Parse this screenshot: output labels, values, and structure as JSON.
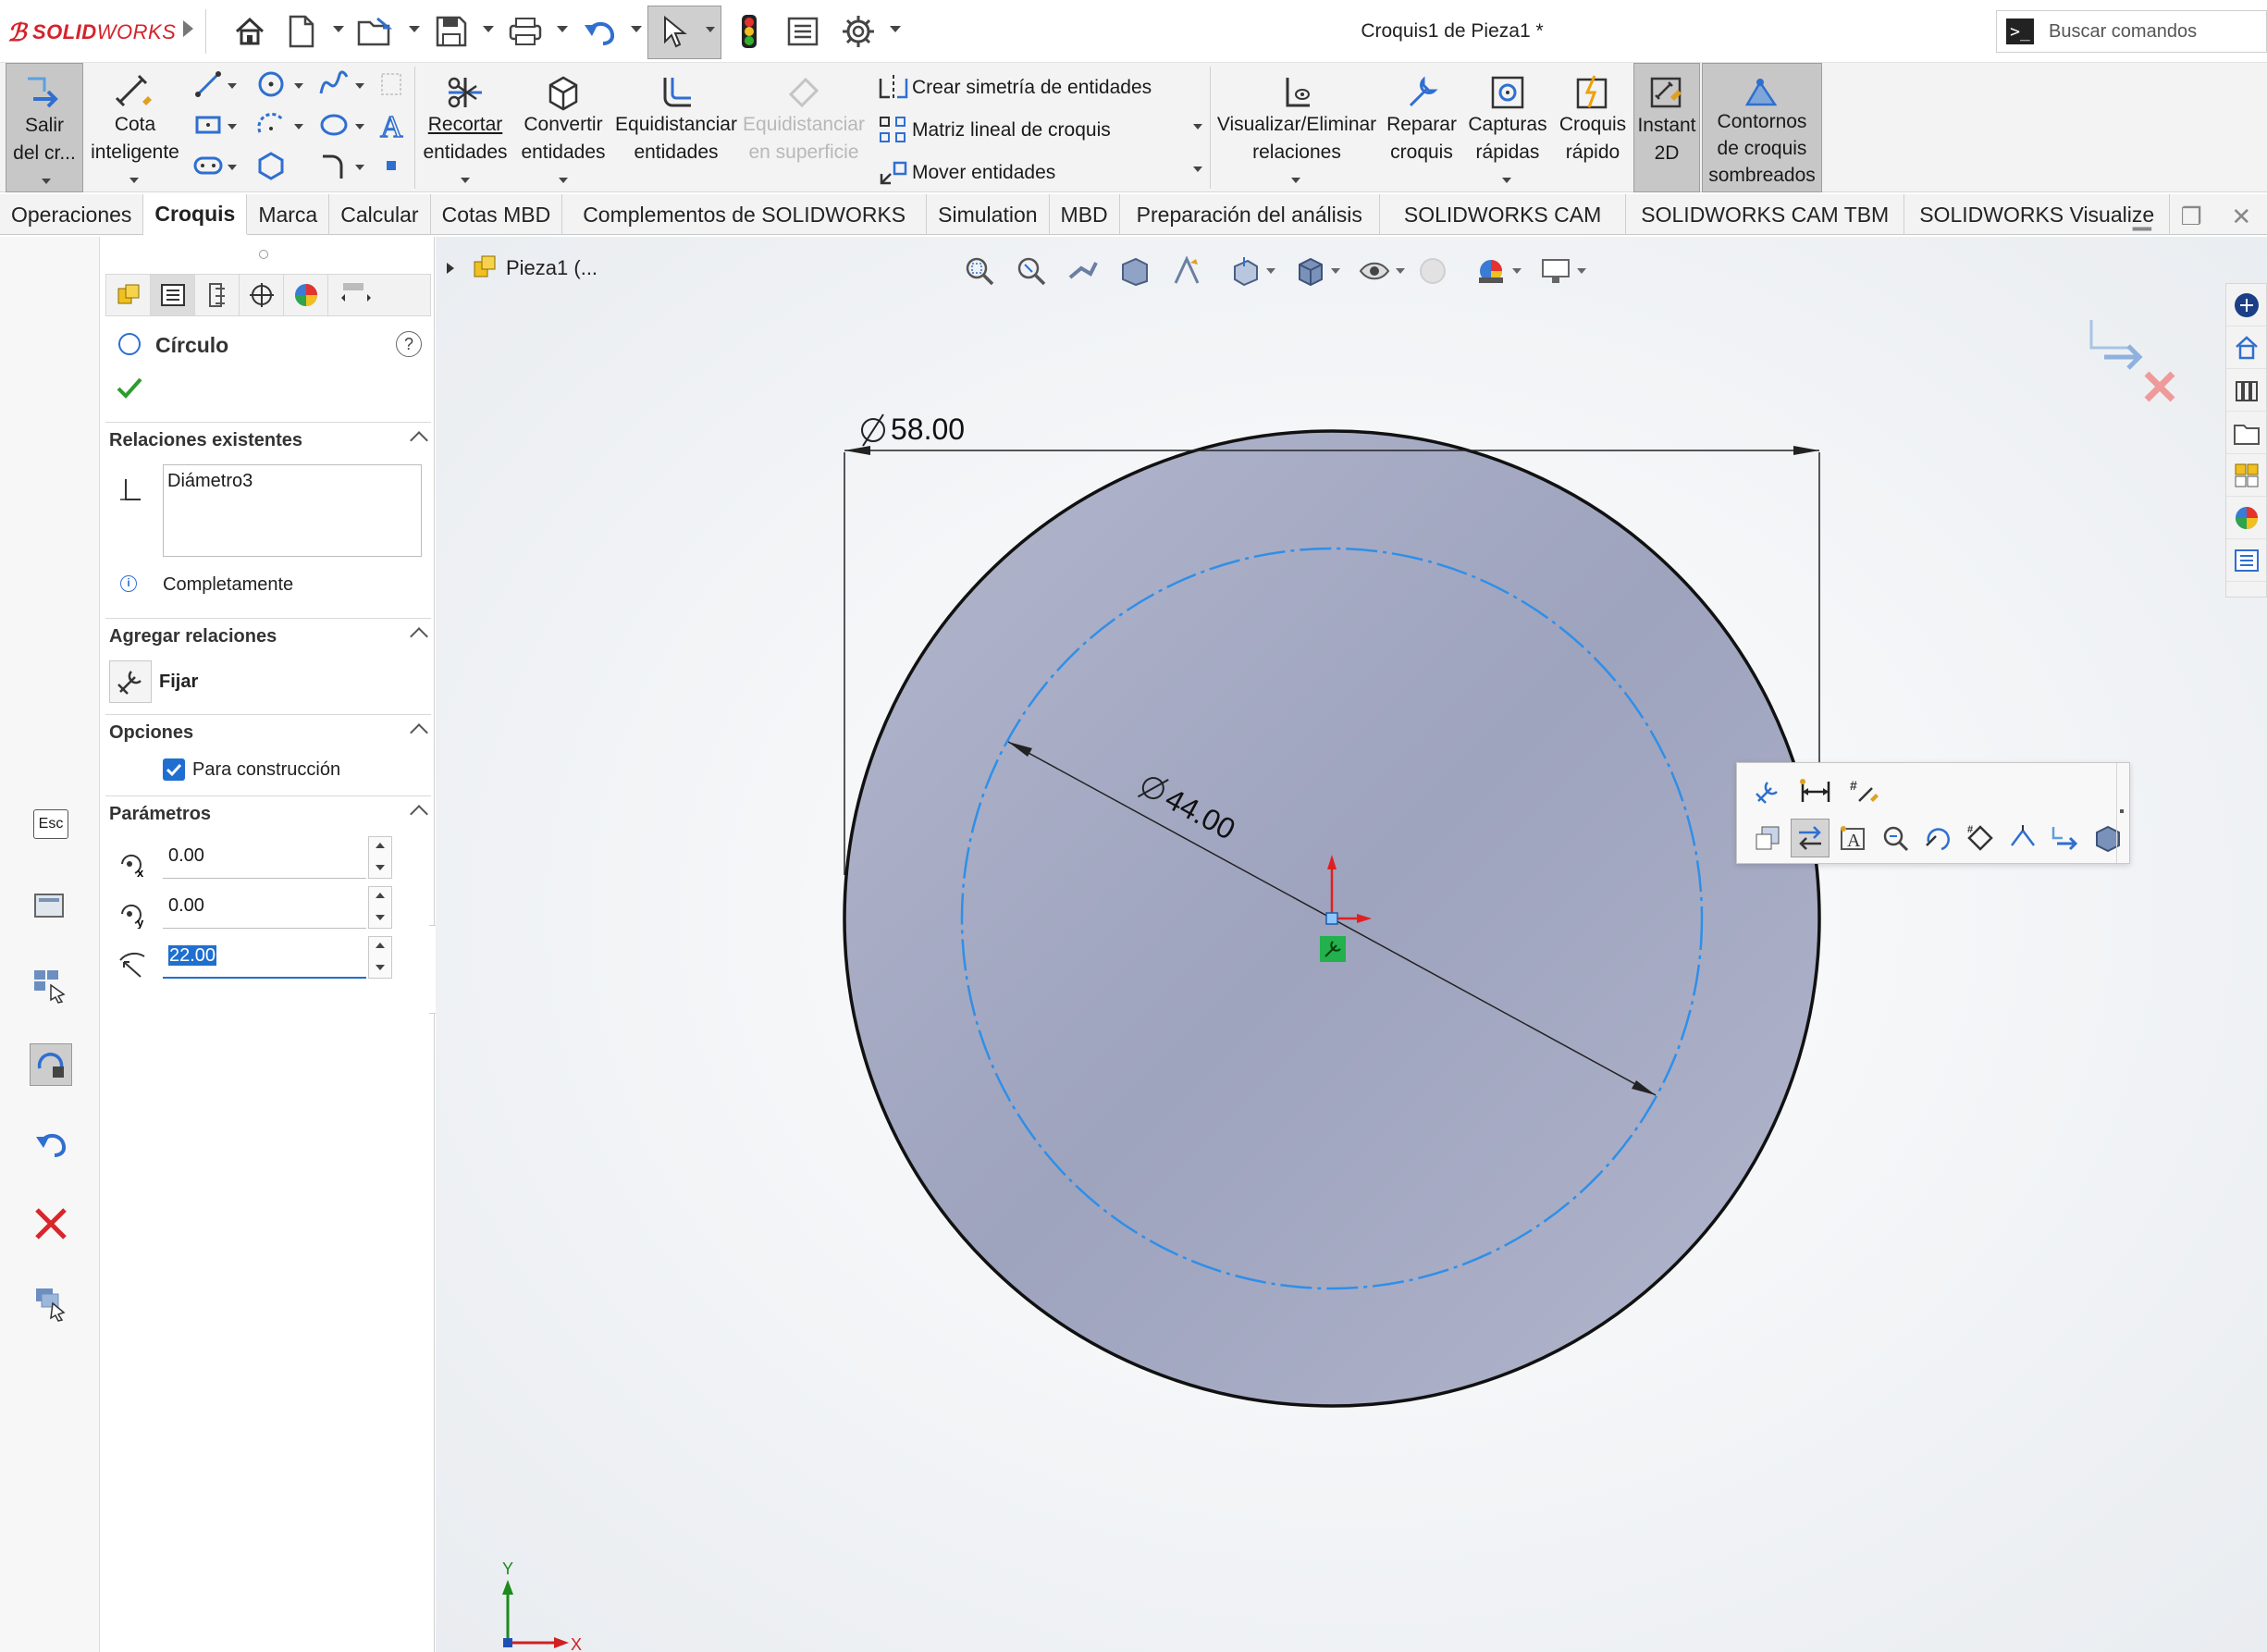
{
  "app": {
    "logo_text_bold": "SOLID",
    "logo_text_light": "WORKS",
    "document_title": "Croquis1 de Pieza1 *",
    "search_placeholder": "Buscar comandos"
  },
  "ribbon": {
    "exit_sketch": [
      "Salir",
      "del cr..."
    ],
    "smart_dimension": [
      "Cota",
      "inteligente"
    ],
    "trim": [
      "Recortar",
      "entidades"
    ],
    "convert": [
      "Convertir",
      "entidades"
    ],
    "offset": [
      "Equidistanciar",
      "entidades"
    ],
    "offset_surface": [
      "Equidistanciar",
      "en superficie"
    ],
    "mirror": "Crear simetría de entidades",
    "linear_pattern": "Matriz lineal de croquis",
    "move": "Mover entidades",
    "display_relations": [
      "Visualizar/Eliminar",
      "relaciones"
    ],
    "repair": [
      "Reparar",
      "croquis"
    ],
    "quick_snaps": [
      "Capturas",
      "rápidas"
    ],
    "rapid_sketch": [
      "Croquis",
      "rápido"
    ],
    "instant2d": [
      "Instant",
      "2D"
    ],
    "shaded_contours": [
      "Contornos",
      "de croquis",
      "sombreados"
    ]
  },
  "tabs": [
    "Operaciones",
    "Croquis",
    "Marca",
    "Calcular",
    "Cotas MBD",
    "Complementos de SOLIDWORKS",
    "Simulation",
    "MBD",
    "Preparación del análisis",
    "SOLIDWORKS CAM",
    "SOLIDWORKS CAM TBM",
    "SOLIDWORKS Visualize"
  ],
  "active_tab": "Croquis",
  "left_tools": {
    "esc_label": "Esc"
  },
  "property_manager": {
    "title": "Círculo",
    "help": "?",
    "existing_relations": {
      "label": "Relaciones existentes",
      "items": [
        "Diámetro3"
      ],
      "status": "Completamente"
    },
    "add_relations": {
      "label": "Agregar relaciones",
      "fix": "Fijar"
    },
    "options": {
      "label": "Opciones",
      "for_construction": "Para construcción",
      "for_construction_checked": true
    },
    "parameters": {
      "label": "Parámetros",
      "cx": "0.00",
      "cy": "0.00",
      "radius": "22.00"
    }
  },
  "viewport": {
    "tree_flyout": "Pieza1 (...",
    "dimension_outer": "58.00",
    "dimension_inner": "44.00",
    "triad_x": "X",
    "triad_y": "Y"
  },
  "colors": {
    "part_fill": "#a6abc4",
    "construction_circle": "#2f8fe8",
    "accent_blue": "#1f6fd0",
    "brand_red": "#d4232b",
    "confirm_green": "#2e9b2e",
    "cancel_red": "#d9262b"
  }
}
